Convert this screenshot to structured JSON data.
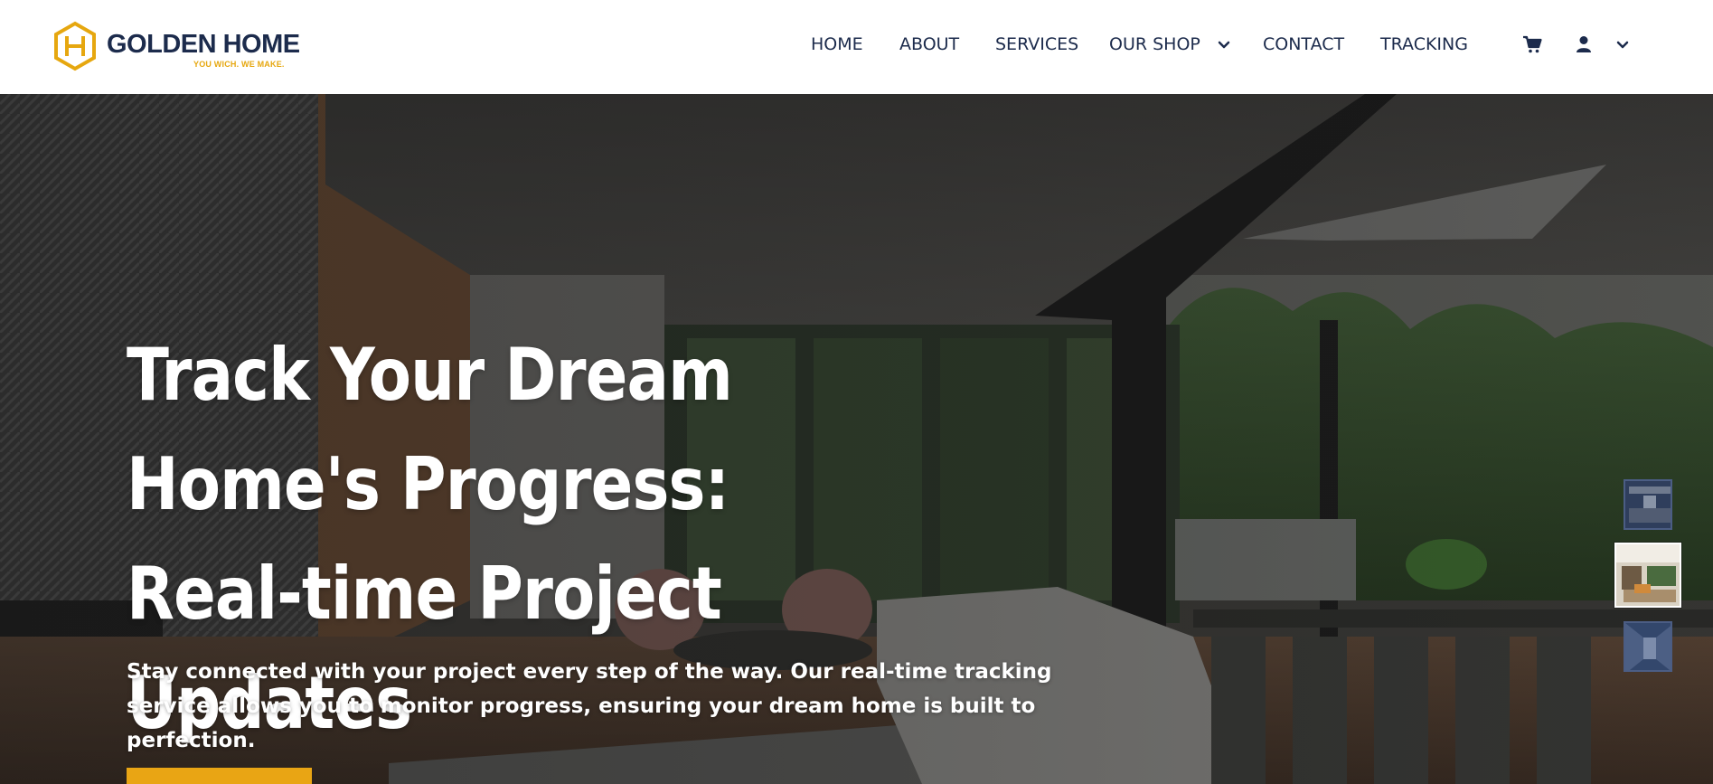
{
  "brand": {
    "name": "GOLDEN HOME",
    "tagline": "YOU WICH. WE MAKE.",
    "logo_icon": "hexagon-h-logo",
    "primary_color": "#1c2b4c",
    "accent_color": "#e6a70f"
  },
  "nav": {
    "items": [
      {
        "label": "HOME"
      },
      {
        "label": "ABOUT"
      },
      {
        "label": "SERVICES"
      },
      {
        "label": "OUR SHOP",
        "has_dropdown": true
      },
      {
        "label": "CONTACT"
      },
      {
        "label": "TRACKING"
      }
    ],
    "icons": [
      "cart-icon",
      "user-icon",
      "chevron-down-icon"
    ]
  },
  "hero": {
    "title": "Track Your Dream Home's Progress: Real-time Project Updates",
    "subtitle": "Stay connected with your project every step of the way. Our real-time tracking service allows you to monitor progress, ensuring your dream home is built to perfection.",
    "cta_color": "#e9a514",
    "background": "modern living room with open glass doors to outdoor dining patio",
    "thumbnails": [
      {
        "name": "kitchen-interior",
        "active": false
      },
      {
        "name": "living-room-interior",
        "active": true
      },
      {
        "name": "hallway-interior",
        "active": false
      }
    ]
  }
}
